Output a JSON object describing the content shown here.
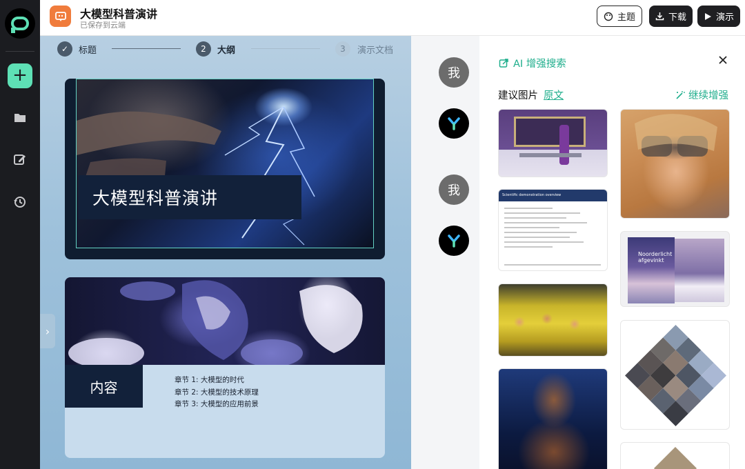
{
  "app": {
    "title": "大模型科普演讲",
    "save_status": "已保存到云端"
  },
  "header": {
    "theme_label": "主题",
    "download_label": "下载",
    "present_label": "演示"
  },
  "rail": {
    "icons": [
      "add-icon",
      "folder-icon",
      "edit-icon",
      "history-icon"
    ]
  },
  "steps": [
    {
      "number": "✓",
      "label": "标题",
      "state": "done"
    },
    {
      "number": "2",
      "label": "大纲",
      "state": "current"
    },
    {
      "number": "3",
      "label": "演示文档",
      "state": "pending"
    }
  ],
  "slides": {
    "cover_title": "大模型科普演讲",
    "content_label": "内容",
    "chapters": [
      "章节 1: 大模型的时代",
      "章节 2: 大模型的技术原理",
      "章节 3: 大模型的应用前景"
    ]
  },
  "chat": {
    "user_avatar_label": "我"
  },
  "panel": {
    "title": "AI 增强搜索",
    "suggested_label": "建议图片",
    "original_link": "原文",
    "continue_label": "继续增强",
    "doc_thumb_title": "Scientific demonstration overview",
    "magazine_title": "Noorderlicht afgevinkt"
  },
  "colors": {
    "accent_green": "#1fae8c",
    "rail_bg": "#1b1c20",
    "add_button": "#5ee0b5",
    "app_icon": "#f07c3c",
    "slide_dark": "#12213a"
  }
}
